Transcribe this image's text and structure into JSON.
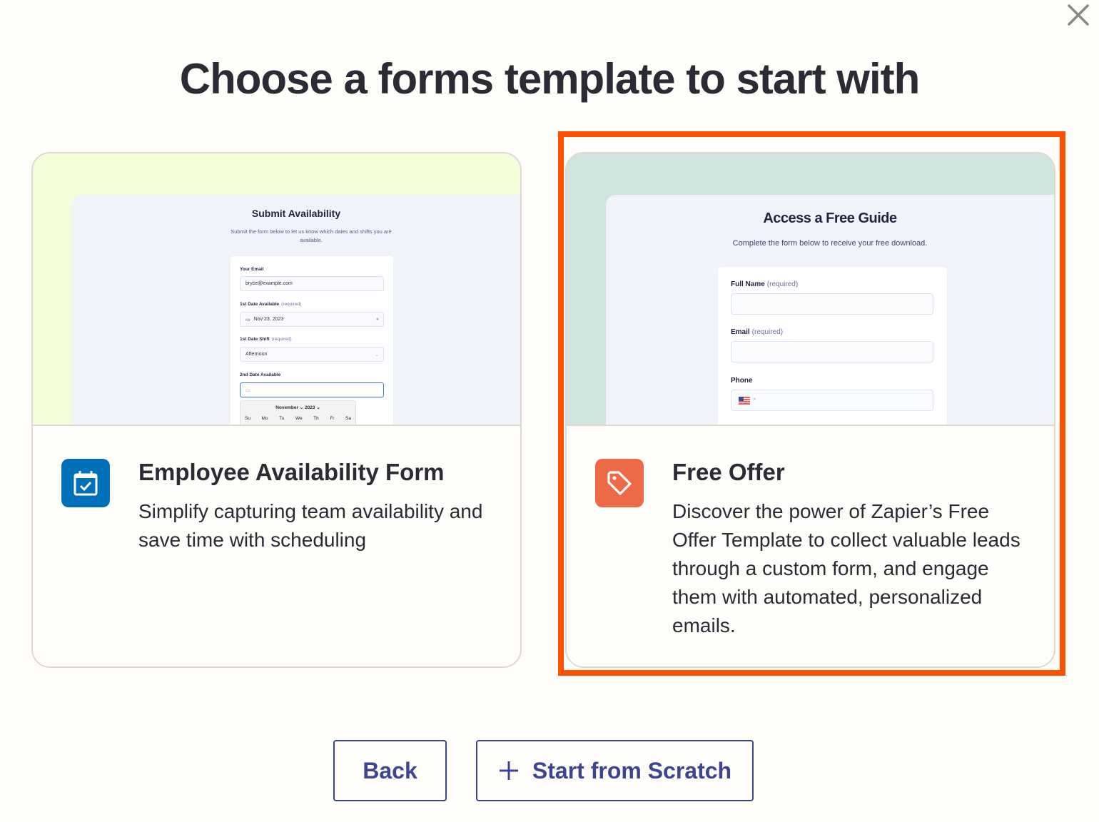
{
  "dialog": {
    "title": "Choose a forms template to start with",
    "close_icon": "close-icon"
  },
  "colors": {
    "highlight": "#ff4f00",
    "button": "#3d4592",
    "employee_icon_bg": "#0071b8",
    "offer_icon_bg": "#ee6a47"
  },
  "templates": [
    {
      "title": "Employee Availability Form",
      "description": "Simplify capturing team availability and save time with scheduling",
      "icon": "calendar-check-icon",
      "preview": {
        "title": "Submit Availability",
        "subtitle": "Submit the form below to let us know which dates and shifts you are available.",
        "fields": [
          {
            "label": "Your Email",
            "required": "",
            "value": "bryce@example.com"
          },
          {
            "label": "1st Date Available",
            "required": "(required)",
            "value": "Nov 23, 2023"
          },
          {
            "label": "1st Date Shift",
            "required": "(required)",
            "value": "Afternoon"
          },
          {
            "label": "2nd Date Available",
            "required": "",
            "value": ""
          }
        ],
        "calendar": {
          "month": "November",
          "year": "2023",
          "days": [
            "Su",
            "Mo",
            "Tu",
            "We",
            "Th",
            "Fr",
            "Sa"
          ]
        }
      }
    },
    {
      "title": "Free Offer",
      "description": "Discover the power of Zapier’s Free Offer Template to collect valuable leads through a custom form, and engage them with automated, personalized emails.",
      "icon": "tag-icon",
      "selected": true,
      "preview": {
        "title": "Access a Free Guide",
        "subtitle": "Complete the form below to receive your free download.",
        "fields": [
          {
            "label": "Full Name",
            "required": "(required)"
          },
          {
            "label": "Email",
            "required": "(required)"
          },
          {
            "label": "Phone",
            "required": ""
          }
        ]
      }
    }
  ],
  "buttons": {
    "back": "Back",
    "scratch": "Start from Scratch"
  }
}
